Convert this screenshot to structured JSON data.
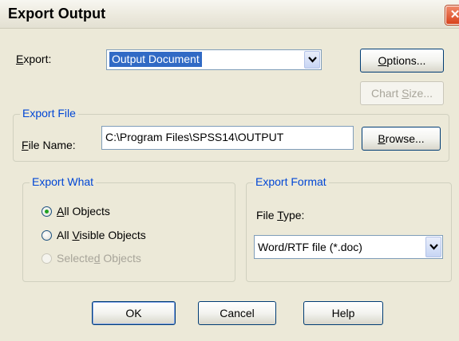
{
  "window": {
    "title": "Export Output",
    "close_glyph": "✕"
  },
  "export": {
    "label_prefix": "",
    "label_key": "E",
    "label_rest": "xport:",
    "selected": "Output Document"
  },
  "buttons": {
    "options": {
      "key": "O",
      "rest": "ptions..."
    },
    "chart_size": {
      "pre": "Chart ",
      "key": "S",
      "rest": "ize..."
    },
    "browse": {
      "key": "B",
      "rest": "rowse..."
    },
    "ok": "OK",
    "cancel": "Cancel",
    "help": "Help"
  },
  "export_file": {
    "legend": "Export File",
    "file_name_key": "F",
    "file_name_rest": "ile Name:",
    "value": "C:\\Program Files\\SPSS14\\OUTPUT"
  },
  "export_what": {
    "legend": "Export What",
    "options": [
      {
        "key": "A",
        "rest": "ll Objects",
        "checked": true,
        "enabled": true
      },
      {
        "pre": "All ",
        "key": "V",
        "rest": "isible Objects",
        "checked": false,
        "enabled": true
      },
      {
        "pre": "Selecte",
        "key": "d",
        "rest": " Objects",
        "checked": false,
        "enabled": false
      }
    ]
  },
  "export_format": {
    "legend": "Export Format",
    "file_type_pre": "File ",
    "file_type_key": "T",
    "file_type_rest": "ype:",
    "selected": "Word/RTF file (*.doc)"
  },
  "colors": {
    "accent": "#0046d5",
    "selection": "#316ac5",
    "dialog_bg": "#ece9d8"
  },
  "icons": {
    "close": "close-icon",
    "dropdown": "chevron-down-icon",
    "radio_dot": "radio-dot-icon"
  }
}
